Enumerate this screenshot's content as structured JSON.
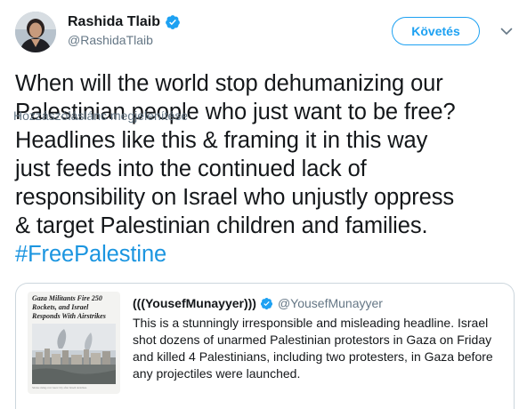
{
  "author": {
    "display_name": "Rashida Tlaib",
    "handle": "@RashidaTlaib",
    "verified": true,
    "avatar_icon": "avatar-photo"
  },
  "follow_button": {
    "label": "Követés"
  },
  "menu": {
    "caret_icon": "chevron-down-icon"
  },
  "tweet": {
    "lines": [
      "When will the world stop dehumanizing our",
      "Palestinian people who just want to be free?",
      "Headlines like this & framing it in this way",
      "just feeds into the continued lack of",
      "responsibility on Israel who unjustly oppress",
      "& target Palestinian children and families."
    ],
    "hashtag": "#FreePalestine"
  },
  "quoted_tweet": {
    "display_name": "(((YousefMunayyer)))",
    "handle": "@YousefMunayyer",
    "verified": true,
    "media": {
      "headline": "Gaza Militants Fire 250 Rockets, and Israel Responds With Airstrikes",
      "caption": "Smoke rising over Gaza City after Israeli airstrikes."
    },
    "lines": [
      "This is a stunningly irresponsible and misleading headline. Israel",
      "shot dozens of unarmed Palestinian protestors in Gaza on Friday",
      "and killed 4 Palestinians, including two protesters, in Gaza before",
      "any projectiles were launched."
    ]
  },
  "show_thread": {
    "label": "Hozzászóláslánc megjelenítése"
  },
  "colors": {
    "accent": "#1da1f2",
    "hashtag": "#1b95e0",
    "text": "#14171a",
    "secondary": "#657786",
    "border": "#ccd6dd"
  }
}
